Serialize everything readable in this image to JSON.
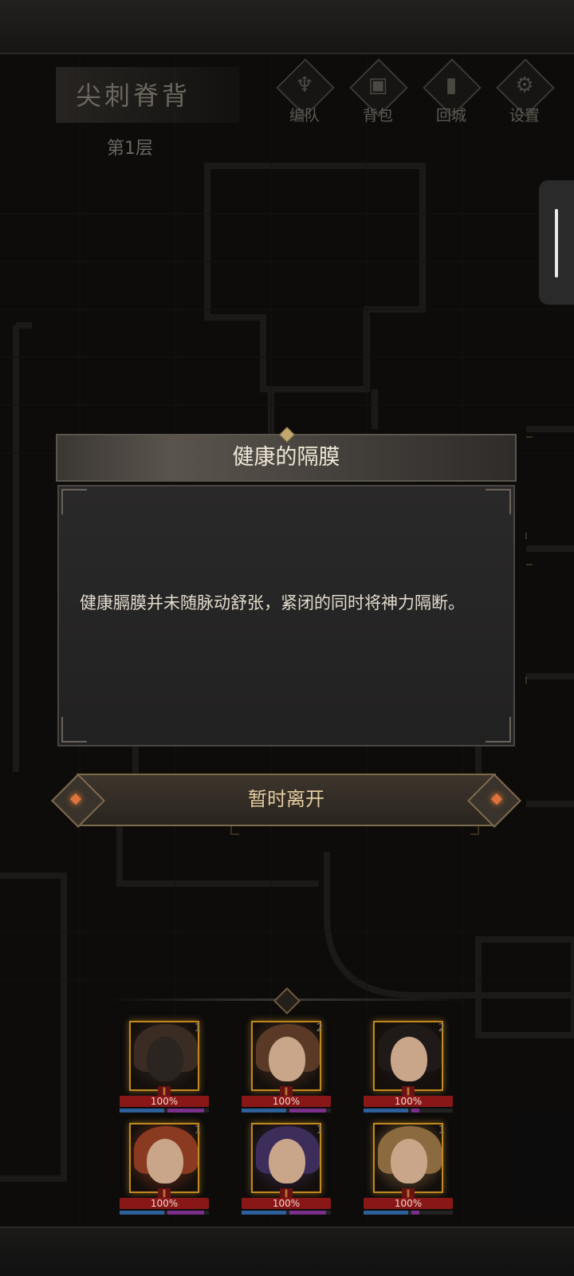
{
  "map": {
    "title": "尖刺脊背",
    "floor": "第1层"
  },
  "nav": [
    {
      "id": "team",
      "label": "编队",
      "icon": "horned-helmet-icon"
    },
    {
      "id": "bag",
      "label": "背包",
      "icon": "backpack-icon"
    },
    {
      "id": "return",
      "label": "回城",
      "icon": "door-exit-icon"
    },
    {
      "id": "settings",
      "label": "设置",
      "icon": "gear-icon"
    }
  ],
  "dialog": {
    "title": "健康的隔膜",
    "text": "健康膈膜并未随脉动舒张，紧闭的同时将神力隔断。",
    "leave_label": "暂时离开"
  },
  "heroes": [
    {
      "name": "dragon",
      "slot": "1",
      "hp": "100%",
      "hp_fraction": 1.0,
      "mp_fraction": 0.5,
      "tone": "#3a2c22"
    },
    {
      "name": "brown-hair-woman",
      "slot": "2",
      "hp": "100%",
      "hp_fraction": 1.0,
      "mp_fraction": 0.5,
      "tone": "#5a3a26"
    },
    {
      "name": "dark-hair-woman",
      "slot": "2",
      "hp": "100%",
      "hp_fraction": 1.0,
      "mp_fraction": 0.5,
      "tone": "#1f1a18"
    },
    {
      "name": "red-hair-woman",
      "slot": "1",
      "hp": "100%",
      "hp_fraction": 1.0,
      "mp_fraction": 0.5,
      "tone": "#8a3a20"
    },
    {
      "name": "purple-hair-elf",
      "slot": "1",
      "hp": "100%",
      "hp_fraction": 1.0,
      "mp_fraction": 0.5,
      "tone": "#3c2d5a"
    },
    {
      "name": "blonde-woman",
      "slot": "1",
      "hp": "100%",
      "hp_fraction": 1.0,
      "mp_fraction": 0.5,
      "tone": "#8a6a3e"
    }
  ],
  "colors": {
    "accent_gold": "#c28a1e",
    "hp_red": "#8a1717",
    "button_text": "#e3cc9f",
    "glow_orange": "#e0733b"
  }
}
